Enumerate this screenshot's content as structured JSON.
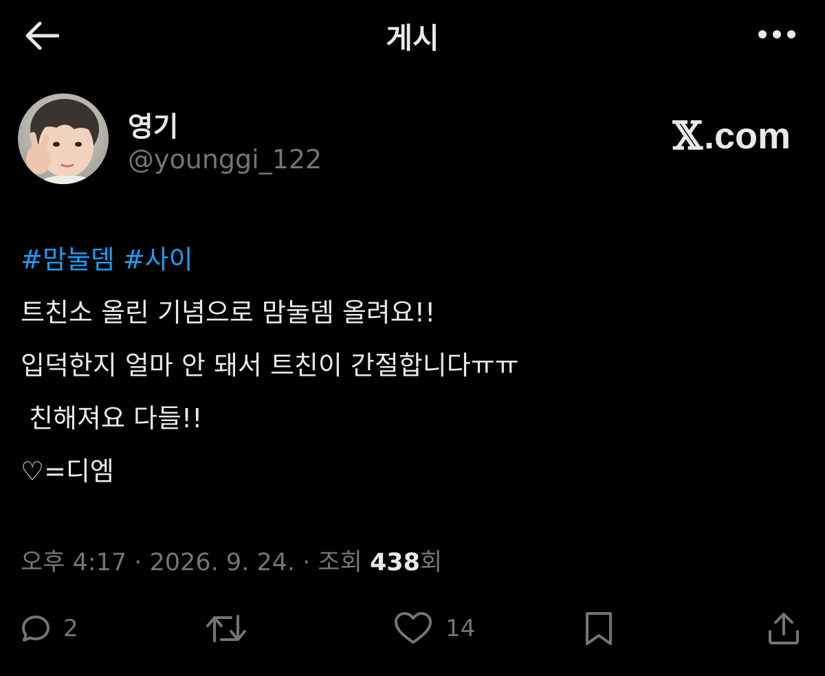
{
  "header": {
    "title": "게시"
  },
  "author": {
    "display_name": "영기",
    "handle": "@younggi_122"
  },
  "watermark": {
    "x_glyph": "𝕏",
    "text": ".com"
  },
  "post": {
    "hashtags": [
      "#맘눌뎀",
      "#사이"
    ],
    "lines": [
      "트친소 올린 기념으로 맘눌뎀 올려요!!",
      "입덕한지 얼마 안 돼서 트친이 간절합니다ㅠㅠ",
      " 친해져요 다들!!",
      "♡=디엠"
    ]
  },
  "meta": {
    "time": "오후 4:17",
    "separator1": " · ",
    "date": "2026. 9. 24.",
    "separator2": " · ",
    "views_label": "조회 ",
    "views_count": "438",
    "views_suffix": "회"
  },
  "actions": {
    "reply_count": "2",
    "like_count": "14"
  },
  "colors": {
    "background": "#000000",
    "text": "#e7e9ea",
    "secondary": "#71767b",
    "accent": "#1d9bf0"
  }
}
